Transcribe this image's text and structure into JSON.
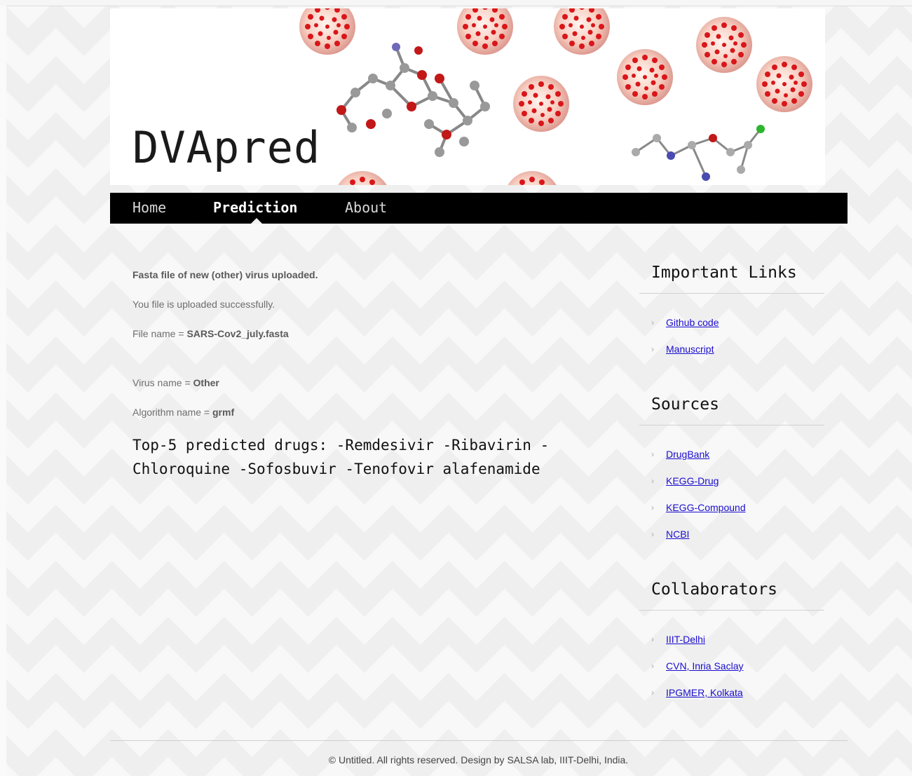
{
  "site": {
    "logo": "DVApred"
  },
  "nav": [
    {
      "label": "Home"
    },
    {
      "label": "Prediction"
    },
    {
      "label": "About"
    }
  ],
  "main": {
    "upload_heading": "Fasta file of new (other) virus uploaded.",
    "upload_status": "You file is uploaded successfully.",
    "file_label": "File name = ",
    "file_value": "SARS-Cov2_july.fasta",
    "virus_label": "Virus name = ",
    "virus_value": "Other",
    "algo_label": "Algorithm name = ",
    "algo_value": "grmf",
    "result_line1": "Top-5 predicted drugs: -Remdesivir -Ribavirin -",
    "result_line2": "Chloroquine -Sofosbuvir -Tenofovir alafenamide"
  },
  "sidebar": {
    "important_links": {
      "title": "Important Links",
      "items": [
        "Github code",
        "Manuscript"
      ]
    },
    "sources": {
      "title": "Sources",
      "items": [
        "DrugBank",
        "KEGG-Drug",
        "KEGG-Compound",
        "NCBI"
      ]
    },
    "collaborators": {
      "title": "Collaborators",
      "items": [
        "IIIT-Delhi",
        "CVN, Inria Saclay",
        "IPGMER, Kolkata"
      ]
    }
  },
  "footer": {
    "text": "© Untitled. All rights reserved. Design by SALSA lab, IIIT-Delhi, India."
  },
  "colors": {
    "link": "#1a0dce",
    "nav_bg": "#000000",
    "virus": "#d9161a"
  },
  "icons": {
    "bullet": "chevron-right-icon"
  }
}
